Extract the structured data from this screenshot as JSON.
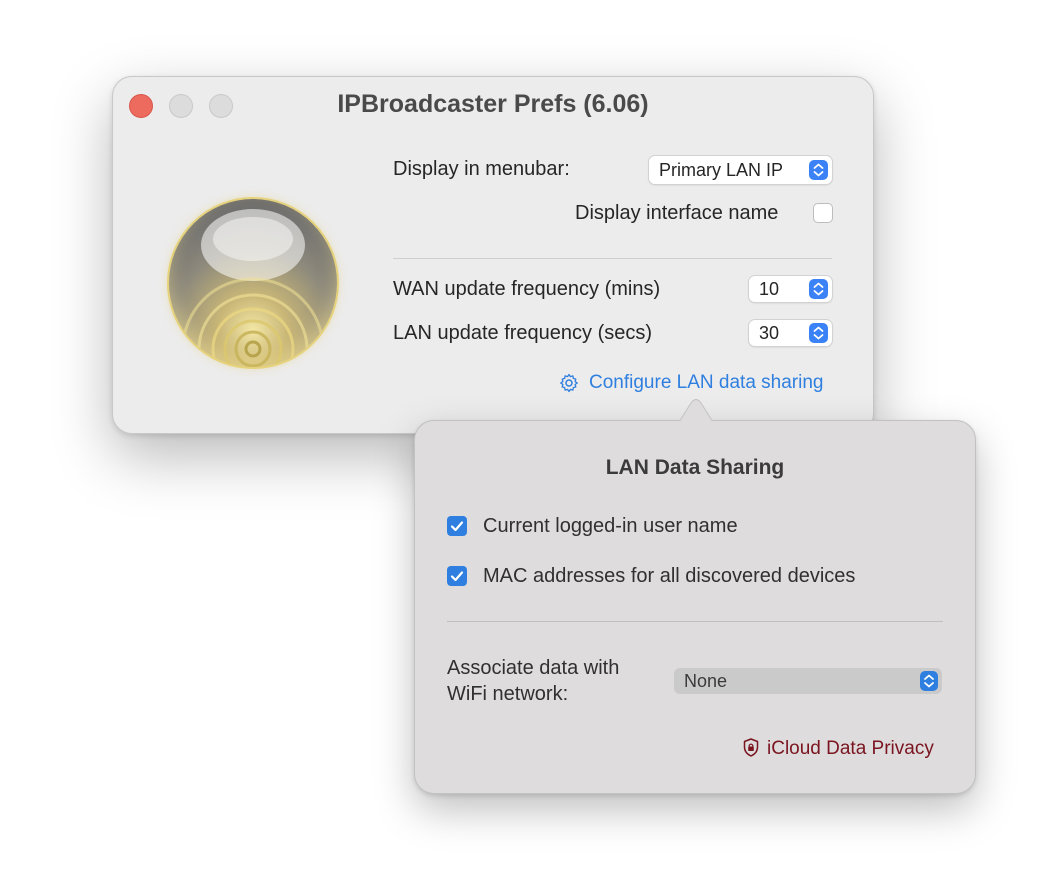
{
  "window": {
    "title": "IPBroadcaster Prefs (6.06)"
  },
  "prefs": {
    "display_in_menubar_label": "Display in menubar:",
    "display_in_menubar_value": "Primary LAN IP",
    "display_interface_name_label": "Display interface name",
    "display_interface_name_checked": false,
    "wan_frequency_label": "WAN update frequency (mins)",
    "wan_frequency_value": "10",
    "lan_frequency_label": "LAN update frequency (secs)",
    "lan_frequency_value": "30",
    "configure_link": "Configure LAN data sharing"
  },
  "popover": {
    "title": "LAN Data Sharing",
    "options": [
      {
        "label": "Current logged-in user name",
        "checked": true
      },
      {
        "label": "MAC addresses for all discovered devices",
        "checked": true
      }
    ],
    "associate_label_line1": "Associate data with",
    "associate_label_line2": "WiFi network:",
    "wifi_value": "None",
    "privacy_link": "iCloud Data Privacy"
  },
  "colors": {
    "accent": "#2f7fe0",
    "privacy_link": "#7a1520",
    "close_button": "#ed6a5e"
  },
  "icons": [
    "close-button",
    "minimize-button",
    "zoom-button",
    "orb-logo",
    "gear-icon",
    "popup-arrows-icon",
    "checkmark-icon",
    "shield-lock-icon"
  ]
}
